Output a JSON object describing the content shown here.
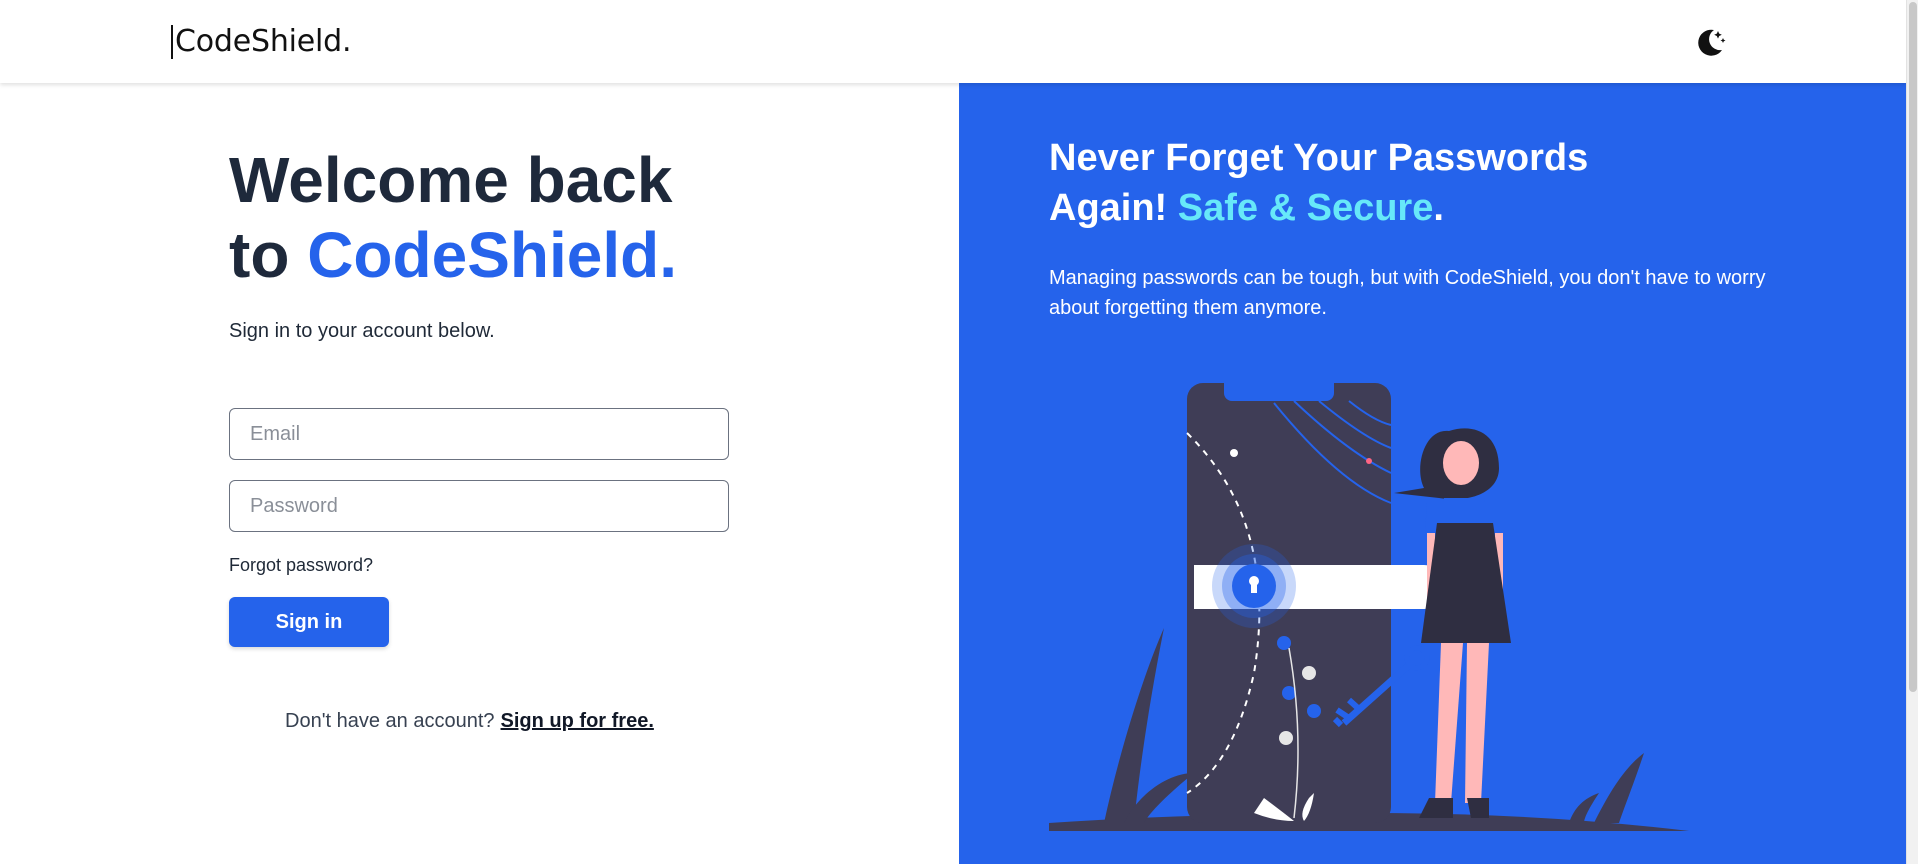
{
  "header": {
    "logo": "CodeShield.",
    "theme_toggle_icon": "moon-stars-icon"
  },
  "login": {
    "title_line1": "Welcome back",
    "title_line2_prefix": "to ",
    "title_line2_brand": "CodeShield.",
    "subtitle": "Sign in to your account below.",
    "email_placeholder": "Email",
    "email_value": "",
    "password_placeholder": "Password",
    "password_value": "",
    "forgot_label": "Forgot password?",
    "signin_label": "Sign in",
    "signup_prompt": "Don't have an account?",
    "signup_link": "Sign up for free."
  },
  "promo": {
    "headline_line1": "Never Forget Your Passwords",
    "headline_line2_prefix": "Again! ",
    "headline_accent": "Safe & Secure",
    "headline_suffix": ".",
    "description": "Managing passwords can be tough, but with CodeShield, you don't have to worry about forgetting them anymore.",
    "illustration_icon": "phone-lock-key-person-illustration"
  },
  "colors": {
    "brand_blue": "#2563eb",
    "accent_cyan": "#67e8f9",
    "heading_dark": "#1e293b"
  }
}
